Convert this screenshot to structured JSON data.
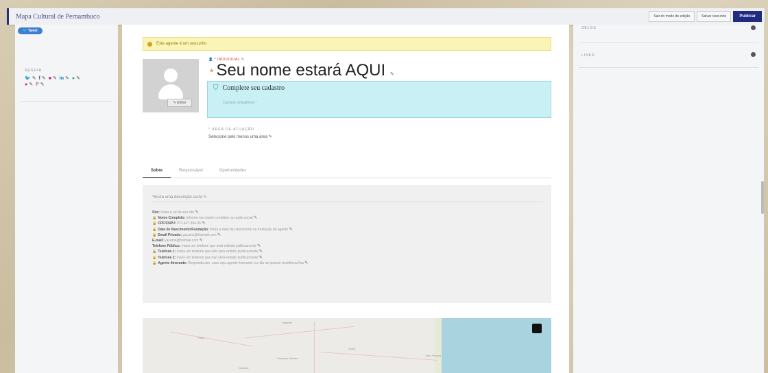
{
  "topbar": {
    "brand": "Mapa Cultural de Pernambuco",
    "actions": [
      "Sair do modo de edição",
      "Salvar rascunho",
      "Publicar"
    ]
  },
  "left": {
    "tweet": "Tweet",
    "follow_label": "SEGUIR",
    "social_icons": [
      "twitter-icon",
      "facebook-icon",
      "instagram-icon",
      "linkedin-icon",
      "spotify-icon",
      "youtube-icon",
      "pinterest-icon"
    ]
  },
  "right": {
    "selos_label": "SELOS",
    "links_label": "LINKS"
  },
  "notice": {
    "text": "Este agente é um rascunho"
  },
  "profile": {
    "type_label": "INDIVIDUAL",
    "name": "Seu nome estará AQUI",
    "edit_avatar": "Editar",
    "complete_title": "Complete seu cadastro",
    "complete_field": "Campos obrigatórios *",
    "area_label": "ÁREA DE ATUAÇÃO",
    "area_value": "Selecione pelo menos uma área"
  },
  "tabs": [
    "Sobre",
    "Responsável",
    "Oportunidades"
  ],
  "about": {
    "description": "*Insira uma descrição curta",
    "fields": [
      {
        "key": "Site:",
        "value": "Insira a url de seu site",
        "locked": false
      },
      {
        "key": "Nome Completo:",
        "value": "Informe seu nome completo ou razão social",
        "locked": true
      },
      {
        "key": "CPF/CNPJ:",
        "value": "071.547.394-06",
        "locked": true
      },
      {
        "key": "Data de Nascimento/Fundação:",
        "value": "Insira a data de nascimento ou fundação do agente",
        "locked": true
      },
      {
        "key": "Email Privado:",
        "value": "yacums@hotmail.com",
        "locked": true
      },
      {
        "key": "E-mail:",
        "value": "yacums@hotmail.com",
        "locked": false
      },
      {
        "key": "Telefone Público:",
        "value": "Insira um telefone que será exibido publicamente",
        "locked": false
      },
      {
        "key": "Telefone 1:",
        "value": "Insira um telefone que não será exibido publicamente",
        "locked": true
      },
      {
        "key": "Telefone 2:",
        "value": "Insira um telefone que não será exibido publicamente",
        "locked": true
      },
      {
        "key": "Agente Itinerante:",
        "value": "Responda sim, caso seja agente itinerante ou não se possuir residência fixa",
        "locked": true
      }
    ]
  },
  "map": {
    "labels": [
      "Itapetim",
      "Patos",
      "Campina Grande",
      "João Pessoa",
      "Sumé",
      "Caruaru"
    ]
  }
}
